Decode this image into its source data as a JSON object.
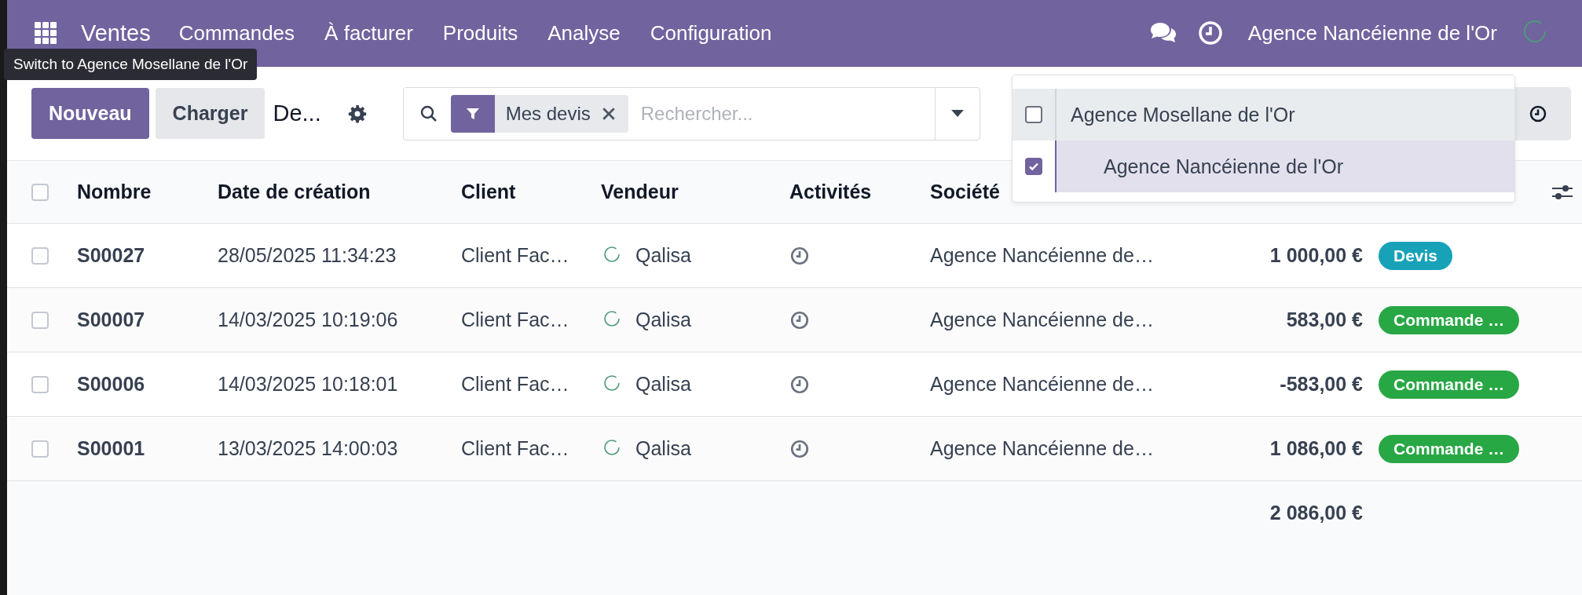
{
  "navbar": {
    "app": "Ventes",
    "menu": [
      "Commandes",
      "À facturer",
      "Produits",
      "Analyse",
      "Configuration"
    ],
    "company": "Agence Nancéienne de l'Or"
  },
  "tooltip": "Switch to Agence Mosellane de l'Or",
  "control_panel": {
    "new_button": "Nouveau",
    "upload_button": "Charger",
    "breadcrumb": "De...",
    "filter_facet": "Mes devis",
    "search_placeholder": "Rechercher..."
  },
  "company_menu": [
    {
      "label": "Agence Mosellane de l'Or",
      "checked": false,
      "hovered": true,
      "children": [
        {
          "label": "Agence Nancéienne de l'Or",
          "checked": true,
          "hovered": false
        }
      ]
    }
  ],
  "table": {
    "all_checked": false,
    "columns": [
      "Nombre",
      "Date de création",
      "Client",
      "Vendeur",
      "Activités",
      "Société"
    ],
    "rows": [
      {
        "checked": false,
        "number": "S00027",
        "date": "28/05/2025 11:34:23",
        "client": "Client Fac…",
        "salesperson": "Qalisa",
        "company": "Agence Nancéienne de…",
        "amount": "1 000,00 €",
        "status": {
          "label": "Devis",
          "color": "#17a2b8"
        }
      },
      {
        "checked": false,
        "number": "S00007",
        "date": "14/03/2025 10:19:06",
        "client": "Client Fac…",
        "salesperson": "Qalisa",
        "company": "Agence Nancéienne de…",
        "amount": "583,00 €",
        "status": {
          "label": "Commande …",
          "color": "#28a745"
        }
      },
      {
        "checked": false,
        "number": "S00006",
        "date": "14/03/2025 10:18:01",
        "client": "Client Fac…",
        "salesperson": "Qalisa",
        "company": "Agence Nancéienne de…",
        "amount": "-583,00 €",
        "status": {
          "label": "Commande …",
          "color": "#28a745"
        }
      },
      {
        "checked": false,
        "number": "S00001",
        "date": "13/03/2025 14:00:03",
        "client": "Client Fac…",
        "salesperson": "Qalisa",
        "company": "Agence Nancéienne de…",
        "amount": "1 086,00 €",
        "status": {
          "label": "Commande …",
          "color": "#28a745"
        }
      }
    ],
    "total": "2 086,00 €"
  }
}
